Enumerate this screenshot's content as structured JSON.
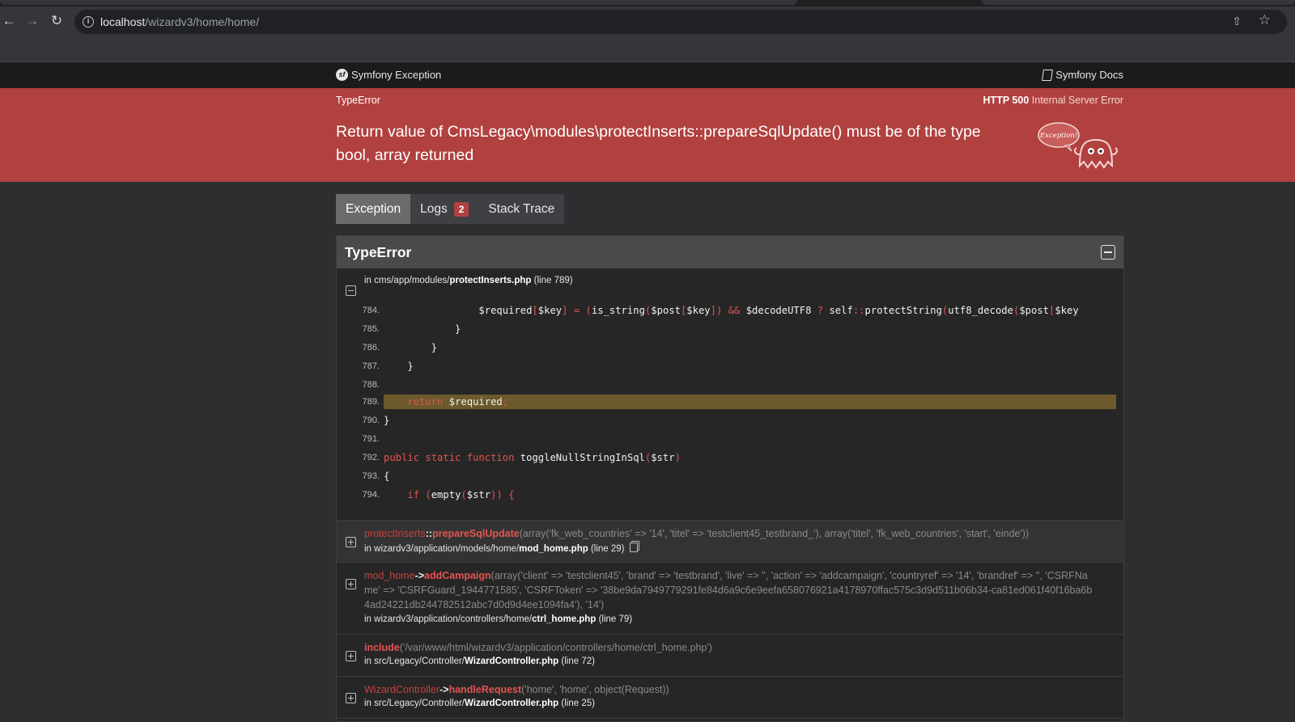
{
  "browser": {
    "url_host": "localhost",
    "url_path": "/wizardv3/home/home/"
  },
  "header": {
    "brand": "Symfony Exception",
    "docs": "Symfony Docs",
    "exception_class": "TypeError",
    "status_code": "HTTP 500",
    "status_text": "Internal Server Error",
    "message": "Return value of CmsLegacy\\modules\\protectInserts::prepareSqlUpdate() must be of the type bool, array returned",
    "mascot_text": "Exception!"
  },
  "tabs": [
    {
      "label": "Exception"
    },
    {
      "label": "Logs",
      "badge": "2"
    },
    {
      "label": "Stack Trace"
    }
  ],
  "panel": {
    "title": "TypeError",
    "first_frame": {
      "prefix": "in ",
      "dir": "cms/app/modules/",
      "file": "protectInserts.php",
      "line": "(line 789)"
    },
    "code_lines": [
      {
        "n": "784.",
        "code": "                $required[$key] = (is_string($post[$key]) && $decodeUTF8 ? self::protectString(utf8_decode($post[$key"
      },
      {
        "n": "785.",
        "code": "            }"
      },
      {
        "n": "786.",
        "code": "        }"
      },
      {
        "n": "787.",
        "code": "    }"
      },
      {
        "n": "788.",
        "code": ""
      },
      {
        "n": "789.",
        "code": "    return $required;"
      },
      {
        "n": "790.",
        "code": "}"
      },
      {
        "n": "791.",
        "code": ""
      },
      {
        "n": "792.",
        "code": "public static function toggleNullStringInSql($str)"
      },
      {
        "n": "793.",
        "code": "{"
      },
      {
        "n": "794.",
        "code": "    if (empty($str)) {"
      }
    ],
    "frames": [
      {
        "cls": "protectInserts",
        "sep": "::",
        "fn": "prepareSqlUpdate",
        "args": "(array('fk_web_countries' => '14', 'titel' => 'testclient45_testbrand_'), array('titel', 'fk_web_countries', 'start', 'einde'))",
        "dir": "wizardv3/application/models/home/",
        "file": "mod_home.php",
        "line": "(line 29)"
      },
      {
        "cls": "mod_home",
        "sep": "->",
        "fn": "addCampaign",
        "args": "(array('client' => 'testclient45', 'brand' => 'testbrand', 'live' => '', 'action' => 'addcampaign', 'countryref' => '14', 'brandref' => '', 'CSRFName' => 'CSRFGuard_1944771585', 'CSRFToken' => '38be9da7949779291fe84d6a9c6e9eefa658076921a4178970ffac575c3d9d511b06b34-ca81ed061f40f16ba6b4ad24221db244782512abc7d0d9d4ee1094fa4'), '14')",
        "dir": "wizardv3/application/controllers/home/",
        "file": "ctrl_home.php",
        "line": "(line 79)"
      },
      {
        "cls": "",
        "sep": "",
        "fn": "include",
        "args": "('/var/www/html/wizardv3/application/controllers/home/ctrl_home.php')",
        "dir": "src/Legacy/Controller/",
        "file": "WizardController.php",
        "line": "(line 72)"
      },
      {
        "cls": "WizardController",
        "sep": "->",
        "fn": "handleRequest",
        "args": "('home', 'home', object(Request))",
        "dir": "src/Legacy/Controller/",
        "file": "WizardController.php",
        "line": "(line 25)"
      }
    ]
  }
}
